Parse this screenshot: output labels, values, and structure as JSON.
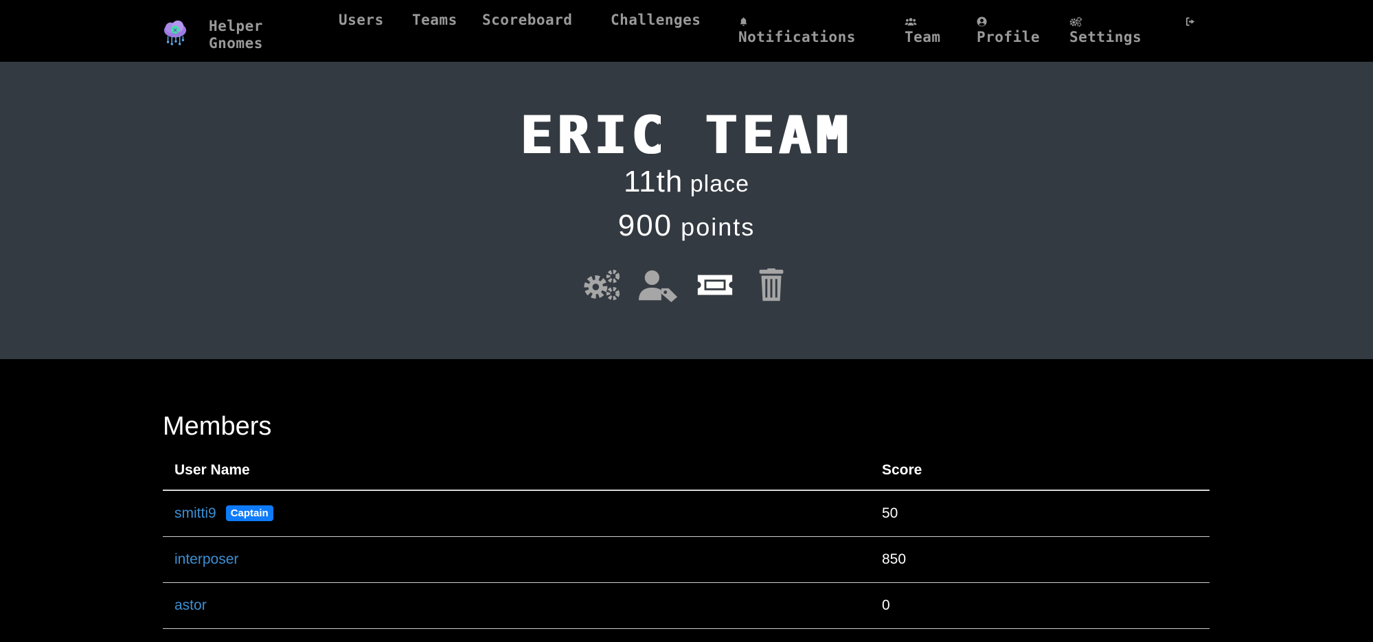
{
  "nav": {
    "brand": "Helper Gnomes",
    "links": [
      {
        "label": "Users"
      },
      {
        "label": "Teams"
      },
      {
        "label": "Scoreboard"
      },
      {
        "label": "Challenges"
      },
      {
        "label": "Notifications",
        "icon": "bell-icon"
      },
      {
        "label": "Team",
        "icon": "users-icon"
      },
      {
        "label": "Profile",
        "icon": "user-circle-icon"
      },
      {
        "label": "Settings",
        "icon": "cogs-icon"
      },
      {
        "icon": "sign-out-icon"
      }
    ]
  },
  "hero": {
    "team_name": "ERIC TEAM",
    "place_number": "11th",
    "place_label": "place",
    "points_number": "900",
    "points_label": "points",
    "actions": [
      "cogs-icon",
      "user-tag-icon",
      "ticket-icon",
      "trash-icon"
    ]
  },
  "members": {
    "title": "Members",
    "columns": [
      "User Name",
      "Score"
    ],
    "rows": [
      {
        "name": "smitti9",
        "badge": "Captain",
        "score": "50"
      },
      {
        "name": "interposer",
        "score": "850"
      },
      {
        "name": "astor",
        "score": "0"
      }
    ]
  },
  "colors": {
    "background": "#000000",
    "hero_background": "#343a42",
    "link": "#3d8fd3",
    "badge": "#0e7bfa",
    "nav_text": "#9a9a9a",
    "icon_gray": "#a6a6a6"
  }
}
